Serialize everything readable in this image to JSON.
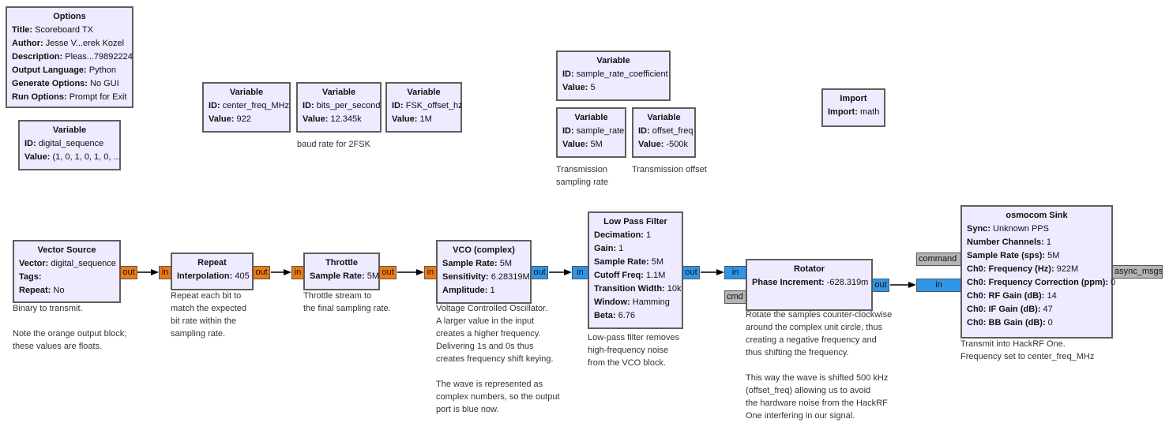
{
  "colors": {
    "block_bg": "#eeeaff",
    "block_border": "#5e5e5e",
    "float_port": "#f07a12",
    "complex_port": "#2d96e8",
    "message_port": "#b4b4b4"
  },
  "blocks": [
    {
      "id": "options",
      "title": "Options",
      "params": [
        {
          "k": "Title",
          "v": "Scoreboard TX"
        },
        {
          "k": "Author",
          "v": "Jesse V...erek Kozel"
        },
        {
          "k": "Description",
          "v": "Pleas...79892224"
        },
        {
          "k": "Output Language",
          "v": "Python"
        },
        {
          "k": "Generate Options",
          "v": "No GUI"
        },
        {
          "k": "Run Options",
          "v": "Prompt for Exit"
        }
      ],
      "ports": []
    },
    {
      "id": "var-digital-sequence",
      "title": "Variable",
      "params": [
        {
          "k": "ID",
          "v": "digital_sequence"
        },
        {
          "k": "Value",
          "v": "(1, 0, 1, 0, 1, 0, ..."
        }
      ],
      "ports": []
    },
    {
      "id": "var-center-freq",
      "title": "Variable",
      "params": [
        {
          "k": "ID",
          "v": "center_freq_MHz"
        },
        {
          "k": "Value",
          "v": "922"
        }
      ],
      "ports": []
    },
    {
      "id": "var-bits-per-second",
      "title": "Variable",
      "params": [
        {
          "k": "ID",
          "v": "bits_per_second"
        },
        {
          "k": "Value",
          "v": "12.345k"
        }
      ],
      "comment": "baud rate for 2FSK",
      "ports": []
    },
    {
      "id": "var-fsk-offset",
      "title": "Variable",
      "params": [
        {
          "k": "ID",
          "v": "FSK_offset_hz"
        },
        {
          "k": "Value",
          "v": "1M"
        }
      ],
      "ports": []
    },
    {
      "id": "var-sample-rate-coefficient",
      "title": "Variable",
      "params": [
        {
          "k": "ID",
          "v": "sample_rate_coefficient"
        },
        {
          "k": "Value",
          "v": "5"
        }
      ],
      "ports": []
    },
    {
      "id": "var-sample-rate",
      "title": "Variable",
      "params": [
        {
          "k": "ID",
          "v": "sample_rate"
        },
        {
          "k": "Value",
          "v": "5M"
        }
      ],
      "comment": "Transmission\nsampling rate",
      "ports": []
    },
    {
      "id": "var-offset-freq",
      "title": "Variable",
      "params": [
        {
          "k": "ID",
          "v": "offset_freq"
        },
        {
          "k": "Value",
          "v": "-500k"
        }
      ],
      "comment": "Transmission offset",
      "ports": []
    },
    {
      "id": "import",
      "title": "Import",
      "params": [
        {
          "k": "Import",
          "v": "math"
        }
      ],
      "ports": []
    },
    {
      "id": "vector-source",
      "title": "Vector Source",
      "params": [
        {
          "k": "Vector",
          "v": "digital_sequence"
        },
        {
          "k": "Tags",
          "v": ""
        },
        {
          "k": "Repeat",
          "v": "No"
        }
      ],
      "comment": "Binary to transmit.\n\nNote the orange output block;\nthese values are floats.",
      "ports": [
        {
          "label": "out",
          "type": "float_port"
        }
      ]
    },
    {
      "id": "repeat",
      "title": "Repeat",
      "params": [
        {
          "k": "Interpolation",
          "v": "405"
        }
      ],
      "comment": "Repeat each bit to\nmatch the expected\nbit rate within the\nsampling rate.",
      "ports": [
        {
          "label": "in",
          "type": "float_port"
        },
        {
          "label": "out",
          "type": "float_port"
        }
      ]
    },
    {
      "id": "throttle",
      "title": "Throttle",
      "params": [
        {
          "k": "Sample Rate",
          "v": "5M"
        }
      ],
      "comment": "Throttle stream to\nthe final sampling rate.",
      "ports": [
        {
          "label": "in",
          "type": "float_port"
        },
        {
          "label": "out",
          "type": "float_port"
        }
      ]
    },
    {
      "id": "vco",
      "title": "VCO (complex)",
      "params": [
        {
          "k": "Sample Rate",
          "v": "5M"
        },
        {
          "k": "Sensitivity",
          "v": "6.28319M"
        },
        {
          "k": "Amplitude",
          "v": "1"
        }
      ],
      "comment": "Voltage Controlled Oscillator.\nA larger value in the input\ncreates a higher frequency.\nDelivering 1s and 0s thus\ncreates frequency shift keying.\n\nThe wave is represented as\ncomplex numbers, so the output\nport is blue now.",
      "ports": [
        {
          "label": "in",
          "type": "float_port"
        },
        {
          "label": "out",
          "type": "complex_port"
        }
      ]
    },
    {
      "id": "low-pass-filter",
      "title": "Low Pass Filter",
      "params": [
        {
          "k": "Decimation",
          "v": "1"
        },
        {
          "k": "Gain",
          "v": "1"
        },
        {
          "k": "Sample Rate",
          "v": "5M"
        },
        {
          "k": "Cutoff Freq",
          "v": "1.1M"
        },
        {
          "k": "Transition Width",
          "v": "10k"
        },
        {
          "k": "Window",
          "v": "Hamming"
        },
        {
          "k": "Beta",
          "v": "6.76"
        }
      ],
      "comment": "Low-pass filter removes\nhigh-frequency noise\nfrom the VCO block.",
      "ports": [
        {
          "label": "in",
          "type": "complex_port"
        },
        {
          "label": "out",
          "type": "complex_port"
        }
      ]
    },
    {
      "id": "rotator",
      "title": "Rotator",
      "params": [
        {
          "k": "Phase Increment",
          "v": "-628.319m"
        }
      ],
      "comment": "Rotate the samples counter-clockwise\naround the complex unit circle, thus\ncreating a negative frequency and\nthus shifting the frequency.\n\nThis way the wave is shifted 500 kHz\n(offset_freq) allowing us to avoid\nthe hardware noise from the HackRF\nOne interfering in our signal.",
      "ports": [
        {
          "label": "in",
          "type": "complex_port"
        },
        {
          "label": "cmd",
          "type": "message_port"
        },
        {
          "label": "out",
          "type": "complex_port"
        }
      ]
    },
    {
      "id": "osmocom-sink",
      "title": "osmocom Sink",
      "params": [
        {
          "k": "Sync",
          "v": "Unknown PPS"
        },
        {
          "k": "Number Channels",
          "v": "1"
        },
        {
          "k": "Sample Rate (sps)",
          "v": "5M"
        },
        {
          "k": "Ch0: Frequency (Hz)",
          "v": "922M"
        },
        {
          "k": "Ch0: Frequency Correction (ppm)",
          "v": "0"
        },
        {
          "k": "Ch0: RF Gain (dB)",
          "v": "14"
        },
        {
          "k": "Ch0: IF Gain (dB)",
          "v": "47"
        },
        {
          "k": "Ch0: BB Gain (dB)",
          "v": "0"
        }
      ],
      "comment": "Transmit into HackRF One.\nFrequency set to center_freq_MHz",
      "ports": [
        {
          "label": "command",
          "type": "message_port"
        },
        {
          "label": "in",
          "type": "complex_port"
        },
        {
          "label": "async_msgs",
          "type": "message_port"
        }
      ]
    }
  ]
}
